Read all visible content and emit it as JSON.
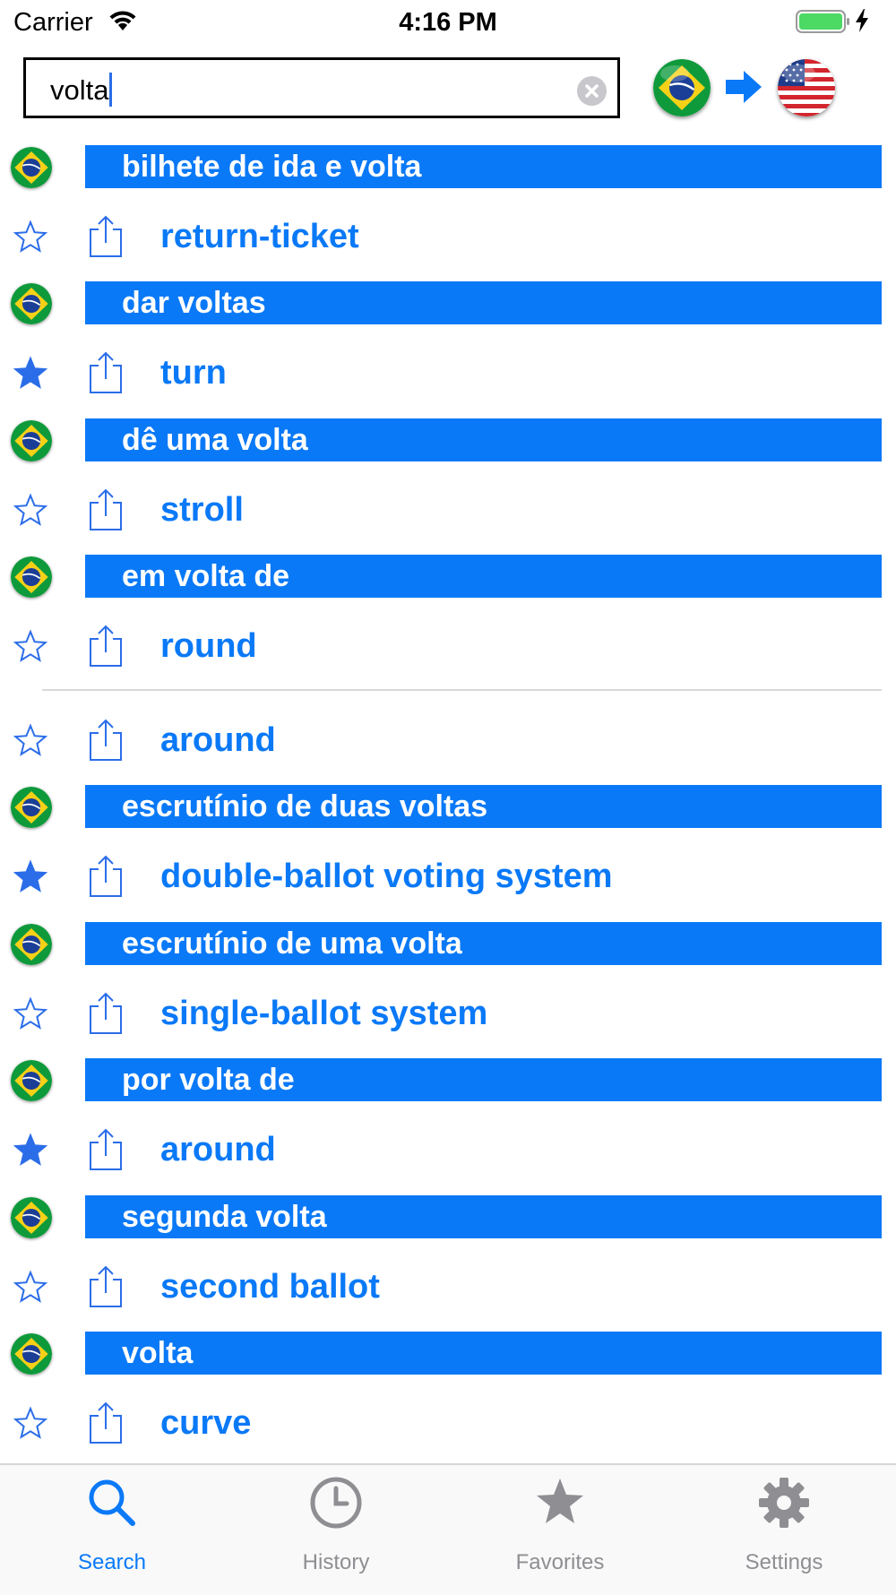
{
  "status_bar": {
    "carrier": "Carrier",
    "time": "4:16 PM"
  },
  "search": {
    "value": "volta"
  },
  "languages": {
    "source": "brazil-flag",
    "target": "usa-flag"
  },
  "colors": {
    "accent": "#0a79f7",
    "header_bg": "#0a79f7",
    "inactive": "#8e8e93"
  },
  "results": [
    {
      "phrase": "bilhete de ida e volta",
      "translations": [
        {
          "text": "return-ticket",
          "favorite": false
        }
      ]
    },
    {
      "phrase": "dar voltas",
      "translations": [
        {
          "text": "turn",
          "favorite": true
        }
      ]
    },
    {
      "phrase": "dê uma volta",
      "translations": [
        {
          "text": "stroll",
          "favorite": false
        }
      ]
    },
    {
      "phrase": "em volta de",
      "translations": [
        {
          "text": "round",
          "favorite": false
        },
        {
          "text": "around",
          "favorite": false
        }
      ]
    },
    {
      "phrase": "escrutínio de duas voltas",
      "translations": [
        {
          "text": "double-ballot voting system",
          "favorite": true
        }
      ]
    },
    {
      "phrase": "escrutínio de uma volta",
      "translations": [
        {
          "text": "single-ballot system",
          "favorite": false
        }
      ]
    },
    {
      "phrase": "por volta de",
      "translations": [
        {
          "text": "around",
          "favorite": true
        }
      ]
    },
    {
      "phrase": "segunda volta",
      "translations": [
        {
          "text": "second ballot",
          "favorite": false
        }
      ]
    },
    {
      "phrase": "volta",
      "translations": [
        {
          "text": "curve",
          "favorite": false
        }
      ]
    }
  ],
  "tabs": [
    {
      "label": "Search",
      "icon": "search-icon",
      "active": true
    },
    {
      "label": "History",
      "icon": "clock-icon",
      "active": false
    },
    {
      "label": "Favorites",
      "icon": "star-icon",
      "active": false
    },
    {
      "label": "Settings",
      "icon": "gear-icon",
      "active": false
    }
  ]
}
